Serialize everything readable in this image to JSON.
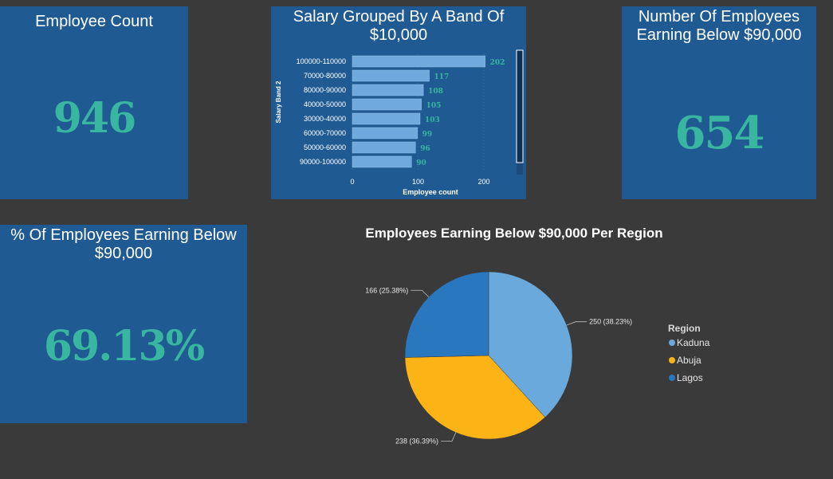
{
  "cards": {
    "employee_count": {
      "title": "Employee Count",
      "value": "946"
    },
    "below_90k": {
      "title": "Number Of Employees Earning Below $90,000",
      "value": "654"
    },
    "pct_below_90k": {
      "title": "% Of Employees Earning Below $90,000",
      "value": "69.13%"
    }
  },
  "colors": {
    "card_bg": "#1f5a92",
    "page_bg": "#3a3a3a",
    "kpi_teal": "#38b6a0",
    "bar_fill": "#6fa9dd",
    "kaduna": "#6aa9dc",
    "abuja": "#fbb316",
    "lagos": "#2877bf"
  },
  "chart_data": [
    {
      "type": "bar",
      "orientation": "horizontal",
      "title": "Salary Grouped By A Band Of $10,000",
      "xlabel": "Employee count",
      "ylabel": "Salary Band 2",
      "categories": [
        "100000-110000",
        "70000-80000",
        "80000-90000",
        "40000-50000",
        "30000-40000",
        "60000-70000",
        "50000-60000",
        "90000-100000"
      ],
      "values": [
        202,
        117,
        108,
        105,
        103,
        99,
        96,
        90
      ],
      "xlim": [
        0,
        240
      ],
      "xticks": [
        0,
        100,
        200
      ],
      "xtick_labels": [
        "0",
        "100",
        "200"
      ],
      "data_labels": true
    },
    {
      "type": "pie",
      "title": "Employees Earning Below $90,000 Per Region",
      "legend_title": "Region",
      "legend_position": "right",
      "slices": [
        {
          "name": "Kaduna",
          "value": 250,
          "label": "250 (38.23%)"
        },
        {
          "name": "Abuja",
          "value": 238,
          "label": "238 (36.39%)"
        },
        {
          "name": "Lagos",
          "value": 166,
          "label": "166 (25.38%)"
        }
      ]
    }
  ]
}
